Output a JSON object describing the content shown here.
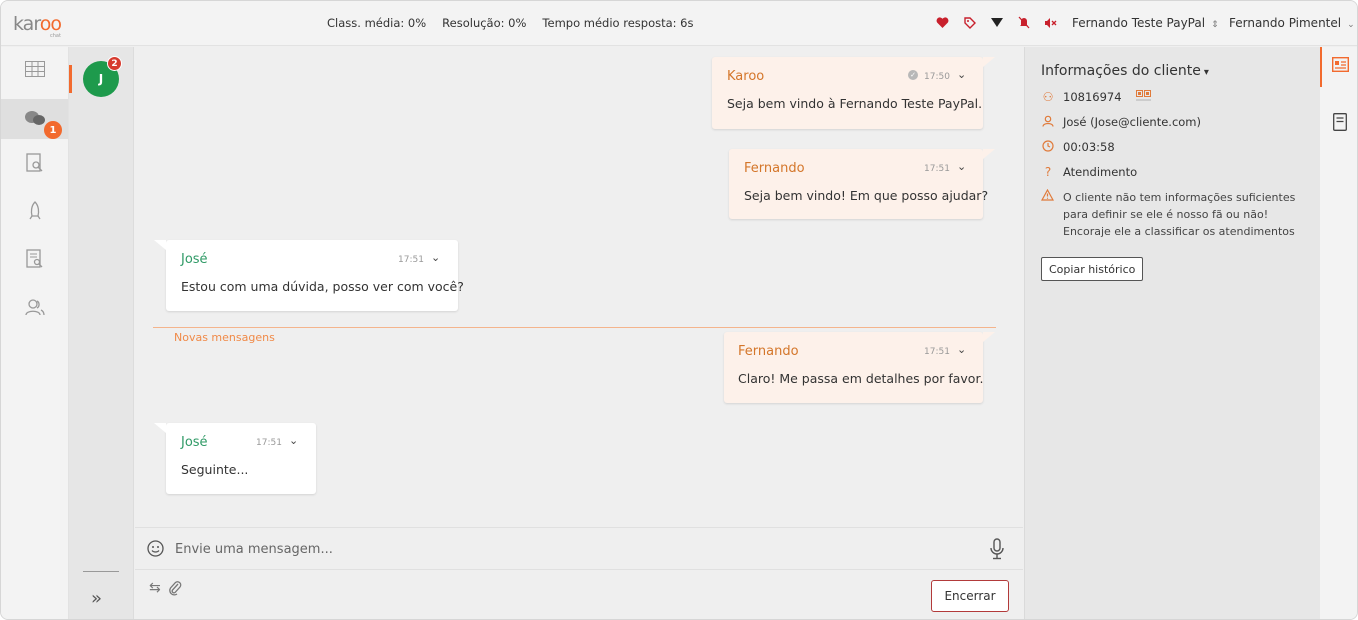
{
  "app": {
    "logo_text": "karoo",
    "logo_sub": "chat"
  },
  "metrics": {
    "avg_class": "Class. média: 0%",
    "resolution": "Resolução: 0%",
    "avg_response": "Tempo médio resposta: 6s"
  },
  "top_icons": [
    "heart-icon",
    "tag-icon",
    "filter-icon",
    "bell-off-icon",
    "sound-off-icon"
  ],
  "account_select": "Fernando Teste PayPal",
  "user_select": "Fernando Pimentel",
  "nav": {
    "chat_badge": "1"
  },
  "contact": {
    "initial": "J",
    "badge": "2"
  },
  "messages": [
    {
      "name": "Karoo",
      "time": "17:50",
      "text": "Seja bem vindo à Fernando Teste PayPal.",
      "check": "✓"
    },
    {
      "name": "Fernando",
      "time": "17:51",
      "text": "Seja bem vindo! Em que posso ajudar?"
    },
    {
      "name": "José",
      "time": "17:51",
      "text": "Estou com uma dúvida, posso ver com você?"
    },
    {
      "name": "Fernando",
      "time": "17:51",
      "text": "Claro! Me passa em detalhes por favor."
    },
    {
      "name": "José",
      "time": "17:51",
      "text": "Seguinte..."
    }
  ],
  "new_messages_label": "Novas mensagens",
  "composer": {
    "placeholder": "Envie uma mensagem..."
  },
  "end_button": "Encerrar",
  "client_info": {
    "title": "Informações do cliente",
    "id": "10816974",
    "contact": "José (Jose@cliente.com)",
    "duration": "00:03:58",
    "type": "Atendimento",
    "warning": "O cliente não tem informações suficientes para definir se ele é nosso fã ou não! Encoraje ele a classificar os atendimentos",
    "copy_button": "Copiar histórico"
  },
  "colors": {
    "accent": "#f26a2e",
    "agent_name": "#d4762a",
    "client_name": "#2f9a66",
    "end_border": "#b23a3a"
  }
}
